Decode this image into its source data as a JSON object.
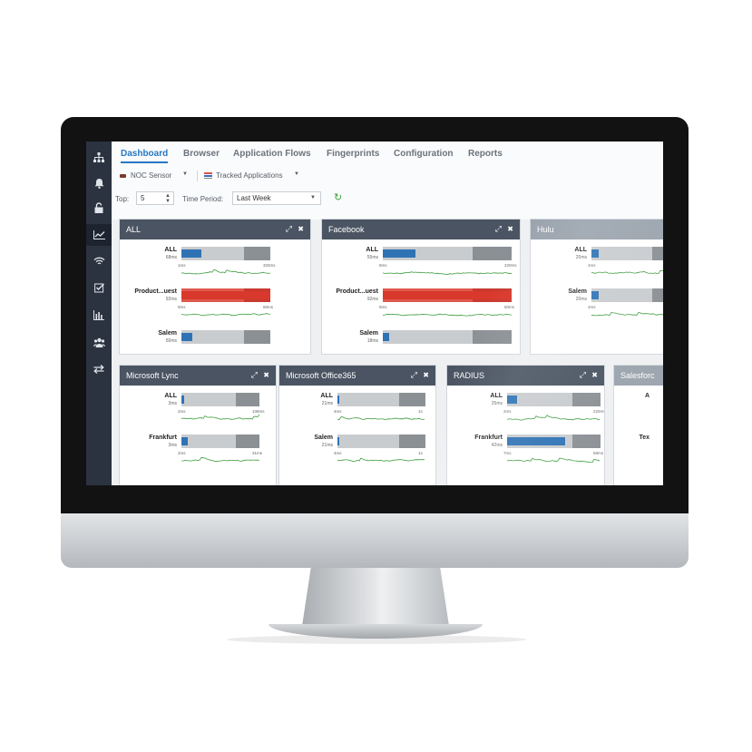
{
  "nav": {
    "tabs": [
      "Dashboard",
      "Browser",
      "Application Flows",
      "Fingerprints",
      "Configuration",
      "Reports"
    ],
    "sidebar_icons": [
      "sitemap-icon",
      "bell-icon",
      "unlock-icon",
      "chart-line-icon",
      "wifi-icon",
      "checkbox-icon",
      "bar-chart-icon",
      "users-icon",
      "exchange-icon"
    ]
  },
  "toolbar": {
    "sensor": "NOC Sensor",
    "apps": "Tracked Applications",
    "top_label": "Top:",
    "top_value": "5",
    "period_label": "Time Period:",
    "period_value": "Last Week"
  },
  "cards": [
    {
      "title": "ALL",
      "rows": [
        {
          "label": "ALL",
          "sub": "68ms",
          "min": "1ms",
          "max": "320ms",
          "value": 0.22,
          "alert": false
        },
        {
          "label": "Product...uest",
          "sub": "92ms",
          "min": "9ms",
          "max": "60ms",
          "value": 1.0,
          "alert": true
        },
        {
          "label": "Salem",
          "sub": "50ms",
          "min": "",
          "max": "",
          "value": 0.12,
          "alert": false
        }
      ]
    },
    {
      "title": "Facebook",
      "rows": [
        {
          "label": "ALL",
          "sub": "55ms",
          "min": "8ms",
          "max": "220ms",
          "value": 0.25,
          "alert": false
        },
        {
          "label": "Product...uest",
          "sub": "92ms",
          "min": "9ms",
          "max": "60ms",
          "value": 1.0,
          "alert": true
        },
        {
          "label": "Salem",
          "sub": "18ms",
          "min": "",
          "max": "",
          "value": 0.05,
          "alert": false
        }
      ]
    },
    {
      "title": "Hulu",
      "rows": [
        {
          "label": "ALL",
          "sub": "20ms",
          "min": "4ms",
          "max": "",
          "value": 0.08,
          "alert": false
        },
        {
          "label": "Salem",
          "sub": "20ms",
          "min": "4ms",
          "max": "",
          "value": 0.08,
          "alert": false
        }
      ]
    },
    {
      "title": "Microsoft Lync",
      "rows": [
        {
          "label": "ALL",
          "sub": "3ms",
          "min": "2ms",
          "max": "108ms",
          "value": 0.03,
          "alert": false
        },
        {
          "label": "Frankfurt",
          "sub": "3ms",
          "min": "2ms",
          "max": "31ms",
          "value": 0.08,
          "alert": false
        }
      ]
    },
    {
      "title": "Microsoft Office365",
      "rows": [
        {
          "label": "ALL",
          "sub": "21ms",
          "min": "4ms",
          "max": "1s",
          "value": 0.02,
          "alert": false
        },
        {
          "label": "Salem",
          "sub": "21ms",
          "min": "4ms",
          "max": "1s",
          "value": 0.02,
          "alert": false
        }
      ]
    },
    {
      "title": "RADIUS",
      "rows": [
        {
          "label": "ALL",
          "sub": "25ms",
          "min": "2ms",
          "max": "220ms",
          "value": 0.11,
          "alert": false
        },
        {
          "label": "Frankfurt",
          "sub": "42ms",
          "min": "7ms",
          "max": "58ms",
          "value": 0.62,
          "alert": false
        }
      ]
    },
    {
      "title": "Salesforc",
      "rows": [
        {
          "label": "A",
          "sub": "",
          "min": "",
          "max": "",
          "value": 0,
          "alert": false
        },
        {
          "label": "Tex",
          "sub": "",
          "min": "",
          "max": "",
          "value": 0,
          "alert": false
        }
      ]
    }
  ],
  "colors": {
    "accent": "#2878c0",
    "bar_fill": "#2f73b5",
    "alert": "#d9382c",
    "header": "#4a5462",
    "spark": "#3a9a3a"
  }
}
